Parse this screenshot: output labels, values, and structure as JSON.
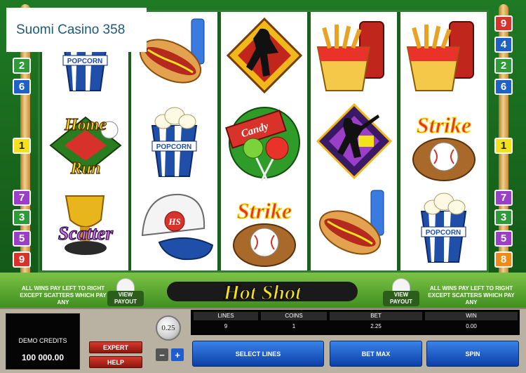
{
  "site": {
    "title": "Suomi Casino 358"
  },
  "game": {
    "logo_text": "Hot Shot",
    "pay_rule_left": "ALL WINS PAY LEFT TO RIGHT EXCEPT SCATTERS WHICH PAY ANY",
    "pay_rule_right": "ALL WINS PAY LEFT TO RIGHT EXCEPT SCATTERS WHICH PAY ANY",
    "view_payout_label": "VIEW PAYOUT"
  },
  "line_markers": {
    "left": [
      "2",
      "6",
      "1",
      "7",
      "3",
      "5",
      "9"
    ],
    "right": [
      "9",
      "4",
      "2",
      "6",
      "1",
      "7",
      "3",
      "5",
      "8"
    ]
  },
  "reels": [
    [
      "popcorn",
      "home-run",
      "scatter"
    ],
    [
      "hotdog",
      "popcorn",
      "cap"
    ],
    [
      "pitcher",
      "candy",
      "strike"
    ],
    [
      "fries",
      "batter",
      "hotdog"
    ],
    [
      "fries",
      "strike",
      "popcorn"
    ]
  ],
  "symbol_text": {
    "popcorn": "POPCORN",
    "home_run_1": "Home",
    "home_run_2": "Run",
    "scatter": "Scatter",
    "candy": "Candy",
    "strike": "Strike",
    "cap": "HS"
  },
  "panel": {
    "credits_label": "DEMO CREDITS",
    "credits_value": "100 000.00",
    "expert_label": "EXPERT",
    "help_label": "HELP",
    "coin_value": "0.25",
    "minus_label": "−",
    "plus_label": "+",
    "fields": [
      {
        "label": "LINES",
        "value": "9"
      },
      {
        "label": "COINS",
        "value": "1"
      },
      {
        "label": "BET",
        "value": "2.25"
      },
      {
        "label": "WIN",
        "value": "0.00"
      }
    ],
    "select_lines_label": "SELECT LINES",
    "bet_max_label": "BET MAX",
    "spin_label": "SPIN"
  },
  "colors": {
    "marker_green": "#2e9a3a",
    "marker_blue": "#1e62c8",
    "marker_yellow": "#f3e11a",
    "marker_purple": "#9b3fc8",
    "marker_orange": "#f28a1a",
    "marker_red": "#d8332b",
    "button_blue": "#1e5ed0",
    "button_red": "#c52a1e"
  }
}
